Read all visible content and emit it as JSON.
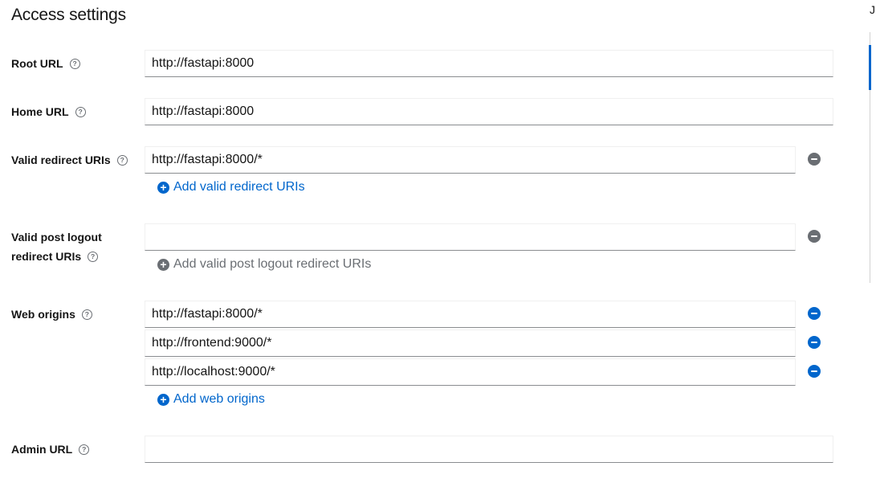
{
  "section": {
    "title": "Access settings"
  },
  "corner_text": "J",
  "fields": {
    "root_url": {
      "label": "Root URL",
      "value": "http://fastapi:8000"
    },
    "home_url": {
      "label": "Home URL",
      "value": "http://fastapi:8000"
    },
    "valid_redirect_uris": {
      "label": "Valid redirect URIs",
      "values": [
        "http://fastapi:8000/*"
      ],
      "add_label": "Add valid redirect URIs"
    },
    "valid_post_logout": {
      "label_line1": "Valid post logout",
      "label_line2": "redirect URIs",
      "values": [
        ""
      ],
      "add_label": "Add valid post logout redirect URIs"
    },
    "web_origins": {
      "label": "Web origins",
      "values": [
        "http://fastapi:8000/*",
        "http://frontend:9000/*",
        "http://localhost:9000/*"
      ],
      "add_label": "Add web origins"
    },
    "admin_url": {
      "label": "Admin URL",
      "value": ""
    }
  },
  "icons": {
    "help": "?",
    "plus": "+"
  },
  "colors": {
    "link_blue": "#0066cc",
    "disabled_grey": "#6a6e73"
  }
}
